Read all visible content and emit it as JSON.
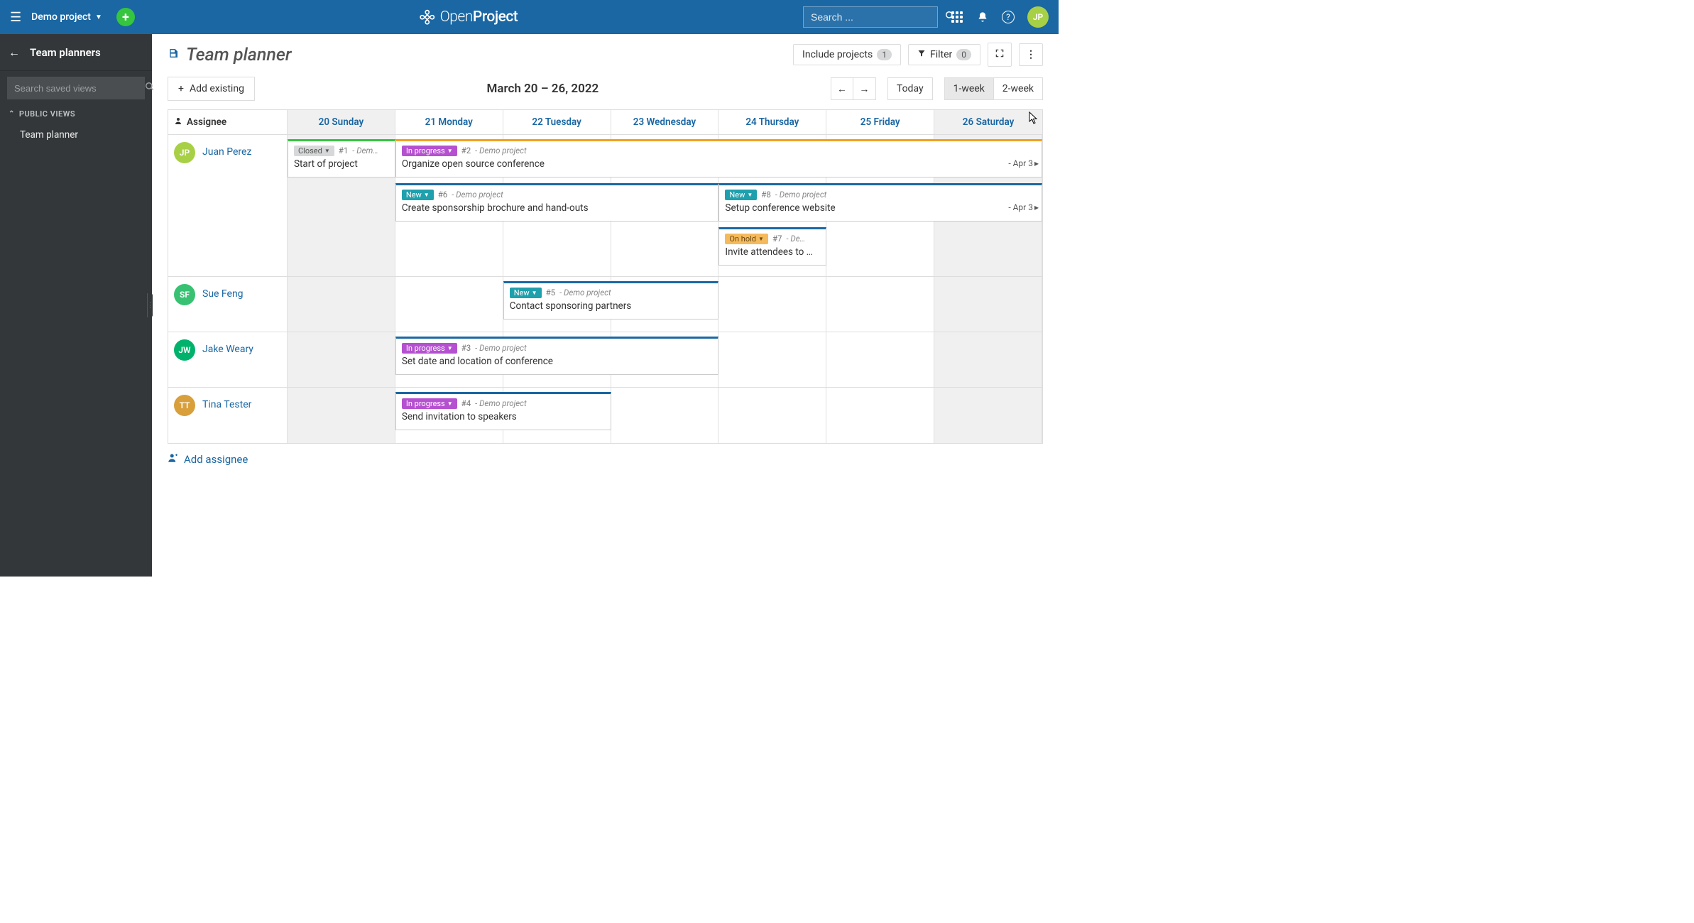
{
  "topbar": {
    "project_name": "Demo project",
    "search_placeholder": "Search ...",
    "avatar_initials": "JP",
    "brand_primary": "OpenProject"
  },
  "sidebar": {
    "title": "Team planners",
    "search_placeholder": "Search saved views",
    "section_label": "PUBLIC VIEWS",
    "items": [
      "Team planner"
    ]
  },
  "page": {
    "title": "Team planner",
    "include_projects_label": "Include projects",
    "include_projects_count": "1",
    "filter_label": "Filter",
    "filter_count": "0",
    "add_existing_label": "Add existing",
    "date_range": "March 20 – 26, 2022",
    "today_label": "Today",
    "view_1week": "1-week",
    "view_2week": "2-week",
    "add_assignee_label": "Add assignee"
  },
  "columns": {
    "assignee": "Assignee",
    "days": [
      {
        "label": "20 Sunday",
        "weekend": true
      },
      {
        "label": "21 Monday",
        "weekend": false
      },
      {
        "label": "22 Tuesday",
        "weekend": false
      },
      {
        "label": "23 Wednesday",
        "weekend": false
      },
      {
        "label": "24 Thursday",
        "weekend": false
      },
      {
        "label": "25 Friday",
        "weekend": false
      },
      {
        "label": "26 Saturday",
        "weekend": true
      }
    ]
  },
  "assignees": [
    {
      "initials": "JP",
      "name": "Juan Perez",
      "color": "jp"
    },
    {
      "initials": "SF",
      "name": "Sue Feng",
      "color": "sf"
    },
    {
      "initials": "JW",
      "name": "Jake Weary",
      "color": "jw"
    },
    {
      "initials": "TT",
      "name": "Tina Tester",
      "color": "tt"
    }
  ],
  "cards": {
    "jp1_status": "Closed",
    "jp1_id": "#1",
    "jp1_proj": "- Dem…",
    "jp1_title": "Start of project",
    "jp2_status": "In progress",
    "jp2_id": "#2",
    "jp2_proj": "- Demo project",
    "jp2_title": "Organize open source conference",
    "jp2_cont": "- Apr 3",
    "jp6_status": "New",
    "jp6_id": "#6",
    "jp6_proj": "- Demo project",
    "jp6_title": "Create sponsorship brochure and hand-outs",
    "jp8_status": "New",
    "jp8_id": "#8",
    "jp8_proj": "- Demo project",
    "jp8_title": "Setup conference website",
    "jp8_cont": "- Apr 3",
    "jp7_status": "On hold",
    "jp7_id": "#7",
    "jp7_proj": "- De…",
    "jp7_title": "Invite attendees to …",
    "sf5_status": "New",
    "sf5_id": "#5",
    "sf5_proj": "- Demo project",
    "sf5_title": "Contact sponsoring partners",
    "jw3_status": "In progress",
    "jw3_id": "#3",
    "jw3_proj": "- Demo project",
    "jw3_title": "Set date and location of conference",
    "tt4_status": "In progress",
    "tt4_id": "#4",
    "tt4_proj": "- Demo project",
    "tt4_title": "Send invitation to speakers"
  }
}
